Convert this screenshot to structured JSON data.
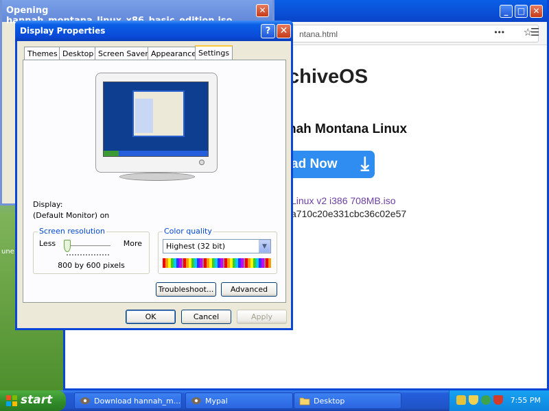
{
  "opening_dialog": {
    "title": "Opening hannah_montana_linux_x86_basic_edition.iso",
    "close_label": "✕"
  },
  "browser": {
    "url": "ntana.html",
    "minimize_label": "_",
    "maximize_label": "□",
    "close_label": "✕",
    "menu_dots": "•••",
    "bookmark_star": "☆",
    "hamburger": "☰",
    "brand": "chiveOS",
    "heading": "nah Montana Linux",
    "download_button": "ad Now",
    "file_link": "Linux v2 i386 708MB.iso",
    "file_hash": "a710c20e331cbc36c02e57"
  },
  "desktop_label": "une",
  "display_properties": {
    "title": "Display Properties",
    "help_label": "?",
    "close_label": "✕",
    "tabs": [
      "Themes",
      "Desktop",
      "Screen Saver",
      "Appearance",
      "Settings"
    ],
    "active_tab": "Settings",
    "display_label": "Display:",
    "display_value": "(Default Monitor) on",
    "screen_resolution": {
      "title": "Screen resolution",
      "less_label": "Less",
      "more_label": "More",
      "value": "800 by 600 pixels",
      "slider_position": 0
    },
    "color_quality": {
      "title": "Color quality",
      "selected": "Highest (32 bit)",
      "arrow": "▼"
    },
    "troubleshoot_label": "Troubleshoot...",
    "advanced_label": "Advanced",
    "ok_label": "OK",
    "cancel_label": "Cancel",
    "apply_label": "Apply"
  },
  "taskbar": {
    "start_label": "start",
    "tasks": [
      {
        "label": "Download hannah_m..."
      },
      {
        "label": "Mypal"
      },
      {
        "label": "Desktop"
      }
    ],
    "clock": "7:55 PM"
  },
  "colors": {
    "xp_blue": "#0a46d6",
    "start_green": "#2f8a27",
    "download_blue": "#2f8df2",
    "link_purple": "#6a3ea0"
  }
}
